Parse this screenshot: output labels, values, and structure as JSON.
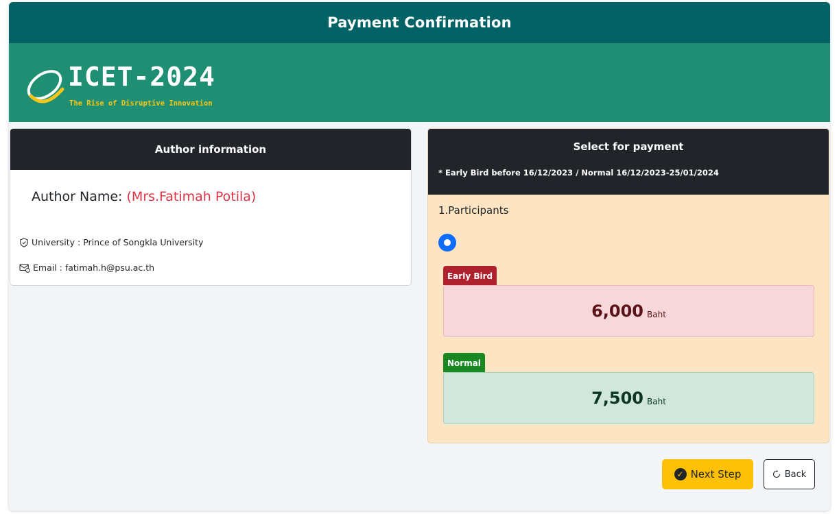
{
  "header": {
    "title": "Payment Confirmation"
  },
  "banner": {
    "logo_text": "ICET-2024",
    "tagline": "The Rise of Disruptive Innovation"
  },
  "author": {
    "card_title": "Author information",
    "name_label": "Author Name:",
    "name_value": "(Mrs.Fatimah Potila)",
    "university": "University : Prince of Songkla University",
    "email": "Email : fatimah.h@psu.ac.th"
  },
  "payment": {
    "card_title": "Select for payment",
    "note": "* Early Bird before 16/12/2023 / Normal 16/12/2023-25/01/2024",
    "section_label": "1.Participants",
    "early": {
      "label": "Early Bird",
      "amount": "6,000",
      "unit": "Baht"
    },
    "normal": {
      "label": "Normal",
      "amount": "7,500",
      "unit": "Baht"
    }
  },
  "actions": {
    "next_label": "Next Step",
    "back_label": "Back"
  },
  "colors": {
    "header": "#036265",
    "banner": "#1f8f74",
    "dark": "#212529",
    "accent_red": "#dc3545",
    "primary": "#0d6efd",
    "warning": "#ffc107"
  }
}
